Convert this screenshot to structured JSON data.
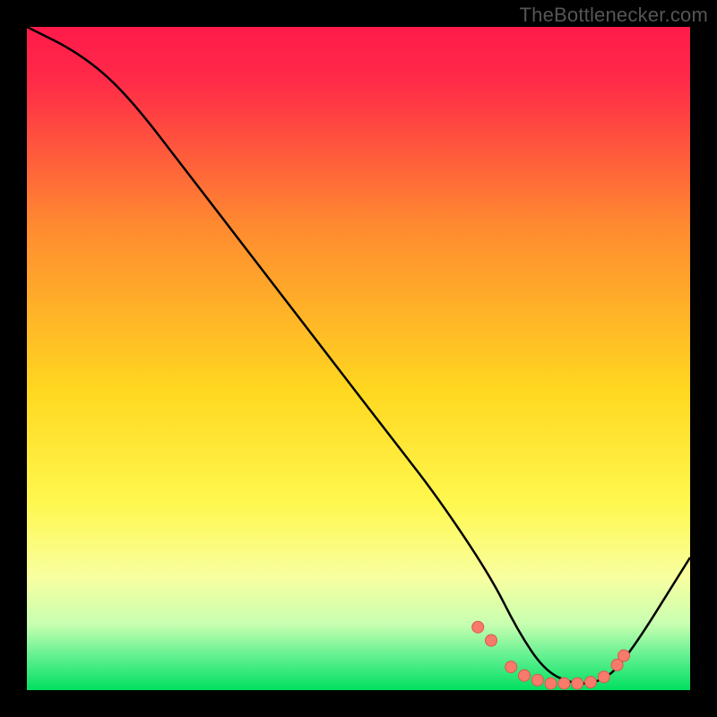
{
  "watermark": "TheBottlenecker.com",
  "colors": {
    "top": "#ff1a4a",
    "mid": "#ffe000",
    "green": "#00e060",
    "curve": "#000000",
    "marker_fill": "#f77a6b",
    "marker_stroke": "#d85a4f"
  },
  "chart_data": {
    "type": "line",
    "title": "",
    "xlabel": "",
    "ylabel": "",
    "xlim": [
      0,
      100
    ],
    "ylim": [
      0,
      100
    ],
    "series": [
      {
        "name": "bottleneck-curve",
        "x": [
          0,
          8,
          15,
          25,
          35,
          45,
          55,
          62,
          70,
          74,
          78,
          82,
          86,
          90,
          100
        ],
        "y": [
          100,
          96,
          90,
          77,
          64,
          51,
          38,
          29,
          17,
          9,
          3,
          1,
          1,
          4,
          20
        ]
      }
    ],
    "markers": {
      "name": "highlight-points",
      "x": [
        68,
        70,
        73,
        75,
        77,
        79,
        81,
        83,
        85,
        87,
        89,
        90
      ],
      "y": [
        9.5,
        7.5,
        3.5,
        2.2,
        1.5,
        1.0,
        1.0,
        1.0,
        1.2,
        2.0,
        3.8,
        5.2
      ]
    },
    "gradient_stops": [
      {
        "offset": 0.0,
        "color": "#ff1a4a"
      },
      {
        "offset": 0.08,
        "color": "#ff2a48"
      },
      {
        "offset": 0.3,
        "color": "#ff8a30"
      },
      {
        "offset": 0.55,
        "color": "#ffd820"
      },
      {
        "offset": 0.72,
        "color": "#fff850"
      },
      {
        "offset": 0.83,
        "color": "#f8ffa0"
      },
      {
        "offset": 0.9,
        "color": "#c8ffb0"
      },
      {
        "offset": 0.95,
        "color": "#60f090"
      },
      {
        "offset": 1.0,
        "color": "#00e060"
      }
    ]
  }
}
